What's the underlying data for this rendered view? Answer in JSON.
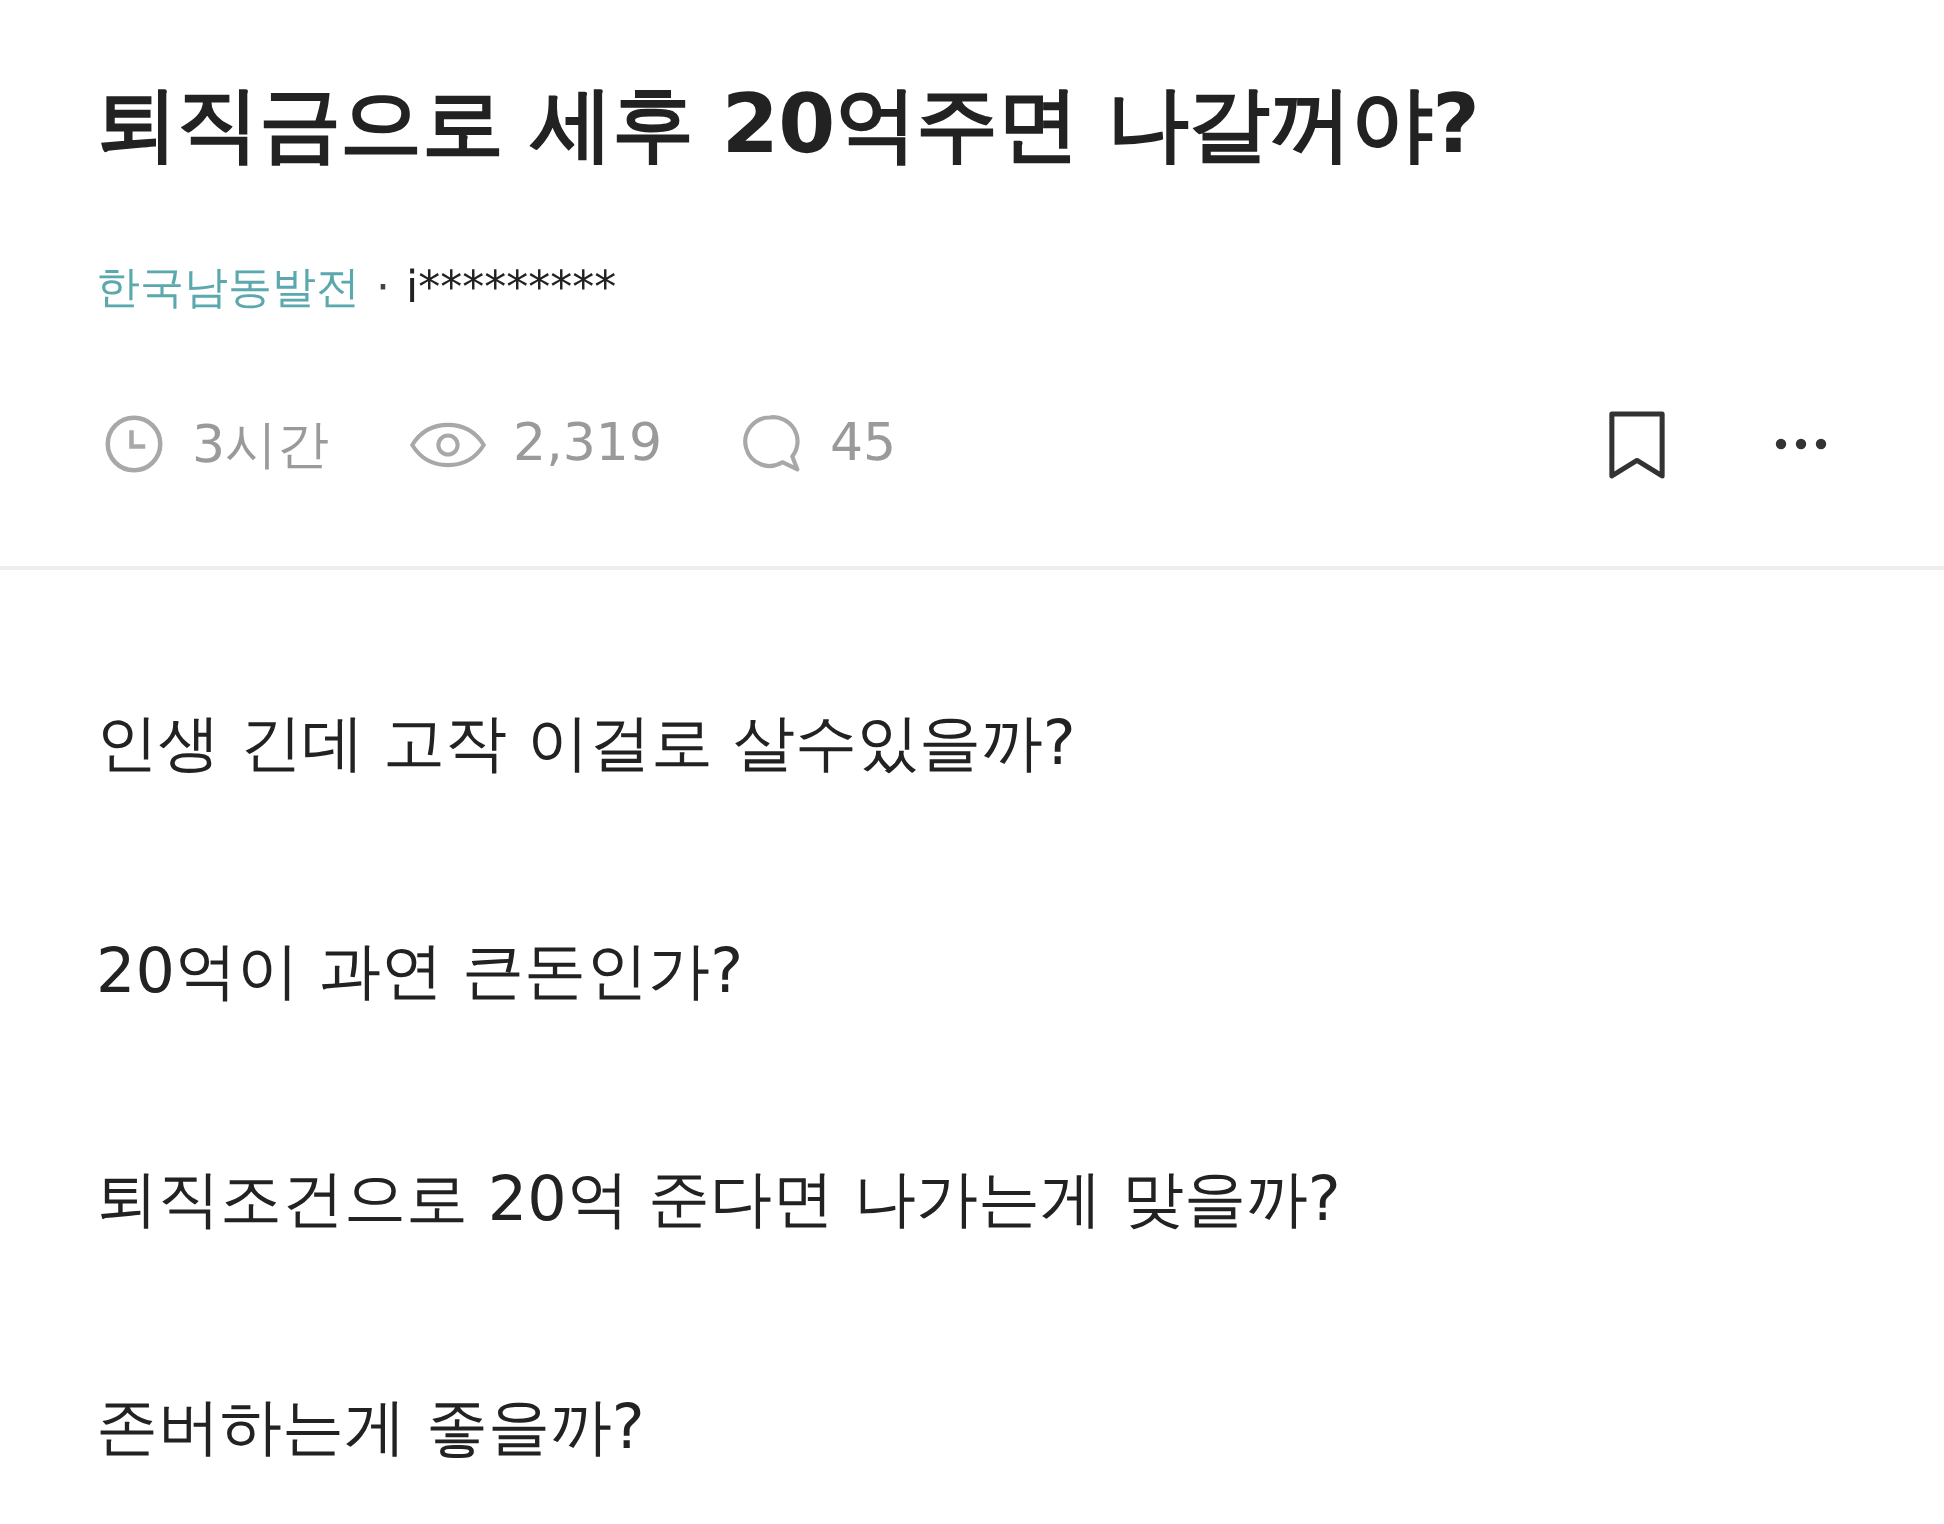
{
  "title": "퇴직금으로 세후 20억주면 나갈꺼야?",
  "author": {
    "company": "한국남동발전",
    "separator": "·",
    "nickname": "i*********"
  },
  "stats": {
    "time": "3시간",
    "views": "2,319",
    "comments": "45"
  },
  "body": [
    "인생 긴데 고작 이걸로 살수있을까?",
    "20억이 과연 큰돈인가?",
    "퇴직조건으로 20억 준다면 나가는게 맞을까?",
    "존버하는게 좋을까?"
  ]
}
